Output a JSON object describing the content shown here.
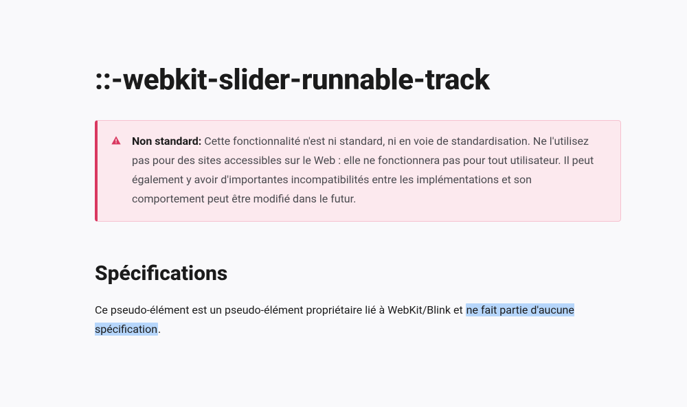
{
  "title": "::-webkit-slider-runnable-track",
  "notice": {
    "label": "Non standard:",
    "text": " Cette fonctionnalité n'est ni standard, ni en voie de standardisation. Ne l'utilisez pas pour des sites accessibles sur le Web : elle ne fonctionnera pas pour tout utilisateur. Il peut également y avoir d'importantes incompatibilités entre les implémentations et son comportement peut être modifié dans le futur.",
    "icon_name": "warning-triangle",
    "icon_color": "#d93860"
  },
  "section": {
    "heading": "Spécifications",
    "paragraph_prefix": "Ce pseudo-élément est un pseudo-élément propriétaire lié à WebKit/Blink et ",
    "highlighted": "ne fait partie d'aucune spécification",
    "suffix": "."
  }
}
